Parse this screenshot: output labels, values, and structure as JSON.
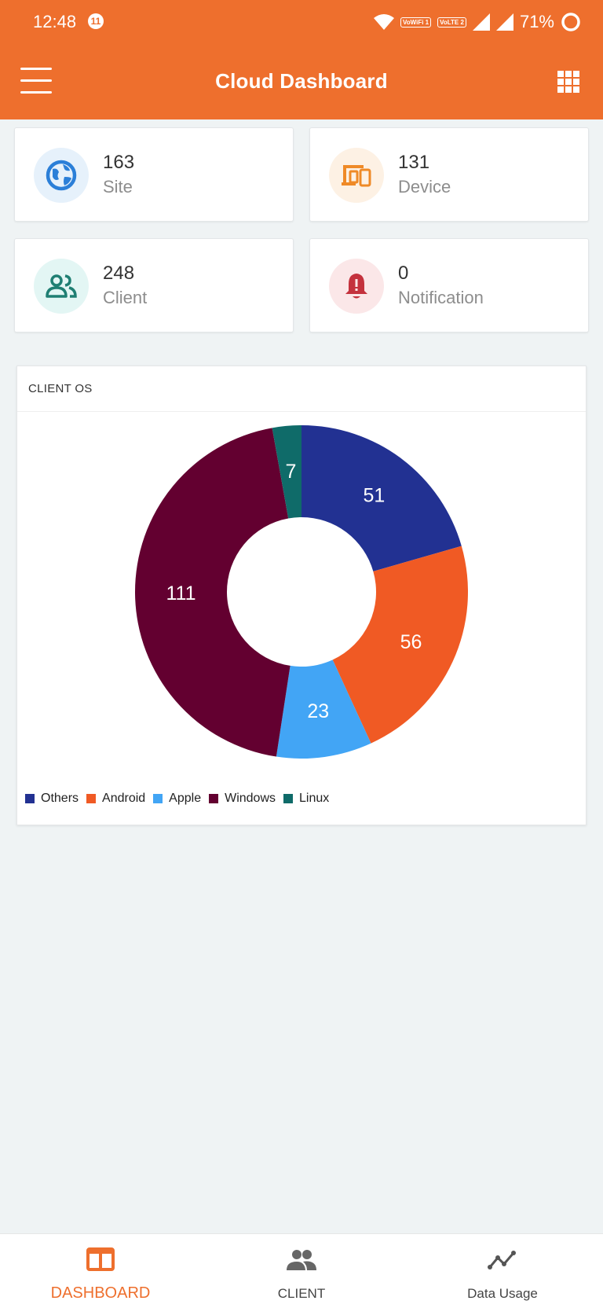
{
  "status_bar": {
    "time": "12:48",
    "notification_count": "11",
    "wifi_badge": "VoWiFi 1",
    "lte_badge": "VoLTE 2",
    "battery": "71%"
  },
  "app_bar": {
    "title": "Cloud Dashboard"
  },
  "stats": [
    {
      "value": "163",
      "label": "Site",
      "icon": "globe-icon",
      "color": "#2b7fd8",
      "bg": "#e6f1fb"
    },
    {
      "value": "131",
      "label": "Device",
      "icon": "devices-icon",
      "color": "#ef8a27",
      "bg": "#fdf1e4"
    },
    {
      "value": "248",
      "label": "Client",
      "icon": "users-icon",
      "color": "#1f7f73",
      "bg": "#e3f6f4"
    },
    {
      "value": "0",
      "label": "Notification",
      "icon": "bell-alert-icon",
      "color": "#c4323d",
      "bg": "#fbe7e8"
    }
  ],
  "client_os": {
    "title": "CLIENT OS"
  },
  "chart_data": {
    "type": "pie",
    "title": "CLIENT OS",
    "categories": [
      "Others",
      "Android",
      "Apple",
      "Windows",
      "Linux"
    ],
    "values": [
      51,
      56,
      23,
      111,
      7
    ],
    "colors": [
      "#223192",
      "#f05a24",
      "#42a5f5",
      "#630030",
      "#0f6b69"
    ],
    "legend_position": "bottom-left",
    "donut": true
  },
  "bottom_nav": [
    {
      "label": "DASHBOARD",
      "icon": "dashboard-icon",
      "active": true
    },
    {
      "label": "CLIENT",
      "icon": "client-icon",
      "active": false
    },
    {
      "label": "Data Usage",
      "icon": "data-usage-icon",
      "active": false
    }
  ],
  "theme": {
    "accent": "#ee6f2d"
  }
}
